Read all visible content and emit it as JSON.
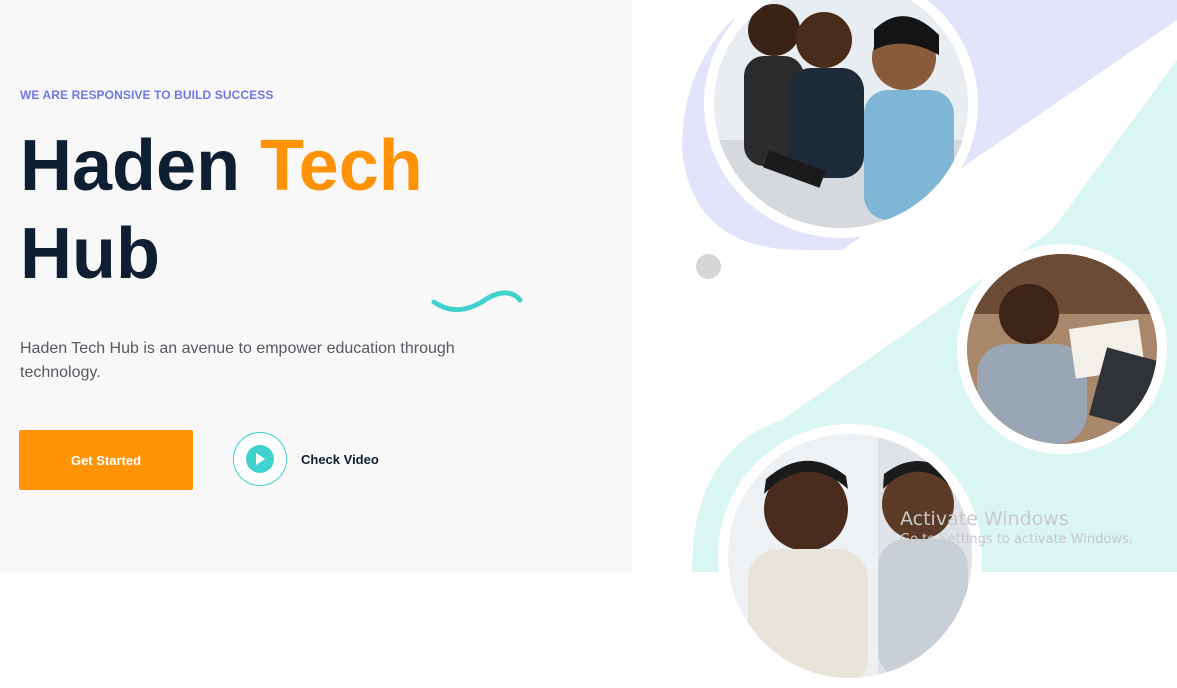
{
  "hero": {
    "eyebrow": "WE ARE RESPONSIVE TO BUILD SUCCESS",
    "title_part1": "Haden ",
    "title_accent": "Tech",
    "title_part2": "Hub",
    "description": "Haden Tech Hub is an avenue to empower education through technology.",
    "cta_label": "Get Started",
    "video_label": "Check Video"
  },
  "watermark": {
    "title": "Activate Windows",
    "subtitle": "Go to Settings to activate Windows."
  },
  "icons": {
    "play": "play-icon",
    "squiggle": "wave-decoration",
    "photos": [
      "students-at-laptop-photo",
      "child-writing-photo",
      "smiling-adults-photo"
    ]
  },
  "colors": {
    "accent": "#ff9305",
    "eyebrow": "#6f78e8",
    "teal": "#3fd2cf",
    "heading": "#0f1f33",
    "lavender": "#e2e4fb",
    "mint": "#d9f6f3"
  }
}
